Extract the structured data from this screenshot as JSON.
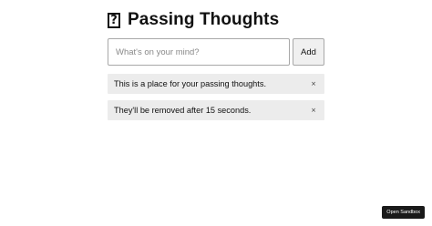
{
  "app": {
    "title_icon": "?",
    "title": "Passing Thoughts"
  },
  "composer": {
    "placeholder": "What's on your mind?",
    "value": "",
    "add_label": "Add"
  },
  "thoughts": [
    {
      "text": "This is a place for your passing thoughts.",
      "remove_label": "×"
    },
    {
      "text": "They'll be removed after 15 seconds.",
      "remove_label": "×"
    }
  ],
  "footer": {
    "sandbox_label": "Open Sandbox"
  },
  "colors": {
    "item_background": "#ececec",
    "sandbox_background": "#1a1a1a"
  }
}
